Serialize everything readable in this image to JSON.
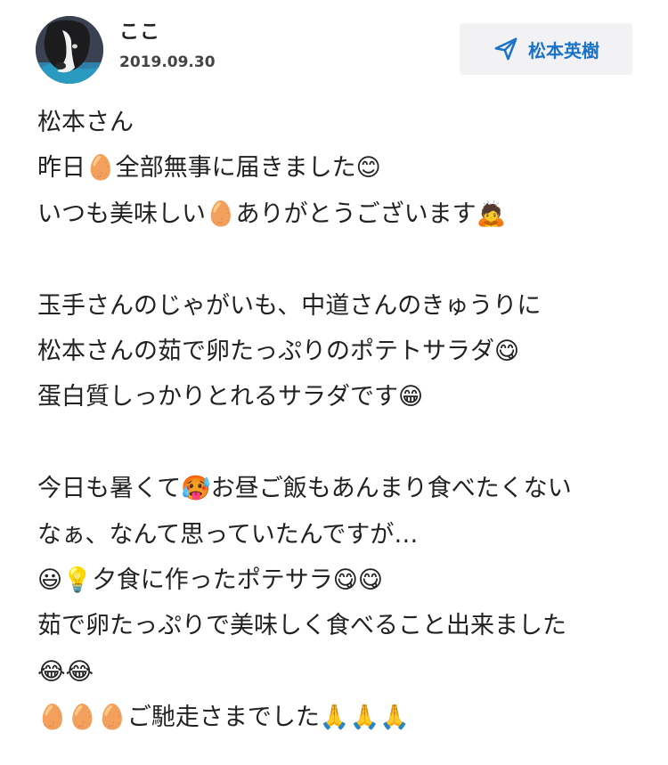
{
  "post": {
    "author": "ここ",
    "date": "2019.09.30",
    "reply_button_label": "松本英樹",
    "icons": {
      "avatar": "dog-avatar",
      "reply": "send-icon"
    }
  },
  "message": {
    "lines": [
      "松本さん",
      "昨日🥚全部無事に届きました😊",
      "いつも美味しい🥚ありがとうございます🙇",
      "",
      "玉手さんのじゃがいも、中道さんのきゅうりに",
      "松本さんの茹で卵たっぷりのポテトサラダ😋",
      "蛋白質しっかりとれるサラダです😁",
      "",
      "今日も暑くて🥵お昼ご飯もあんまり食べたくない",
      "なぁ、なんて思っていたんですが…",
      "😃💡夕食に作ったポテサラ😋😋",
      "茹で卵たっぷりで美味しく食べること出来ました",
      "😂😂",
      "🥚🥚🥚ご馳走さまでした🙏🙏🙏"
    ]
  },
  "colors": {
    "accent": "#1a73c8",
    "button_bg": "#f2f2f4",
    "text": "#222222"
  }
}
